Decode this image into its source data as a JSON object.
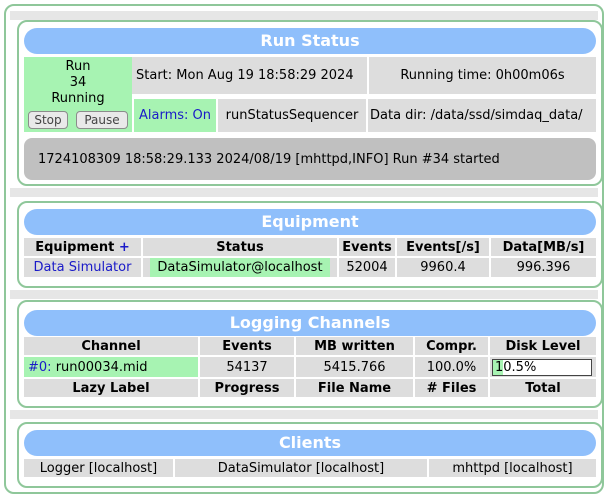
{
  "run_status": {
    "title": "Run Status",
    "run_label": "Run",
    "run_number": "34",
    "run_state": "Running",
    "stop_button": "Stop",
    "pause_button": "Pause",
    "start_time": "Start: Mon Aug 19 18:58:29 2024",
    "running_time": "Running time: 0h00m06s",
    "alarms": "Alarms: On",
    "sequencer": "runStatusSequencer",
    "data_dir": "Data dir: /data/ssd/simdaq_data/",
    "message": "1724108309 18:58:29.133 2024/08/19 [mhttpd,INFO] Run #34 started"
  },
  "equipment": {
    "title": "Equipment",
    "headers": {
      "name": "Equipment",
      "plus": "+",
      "status": "Status",
      "events": "Events",
      "rate": "Events[/s]",
      "data": "Data[MB/s]"
    },
    "rows": [
      {
        "name": "Data Simulator",
        "status": "DataSimulator@localhost",
        "events": "52004",
        "rate": "9960.4",
        "data": "996.396"
      }
    ]
  },
  "logging": {
    "title": "Logging Channels",
    "headers": {
      "channel": "Channel",
      "events": "Events",
      "mb": "MB written",
      "compr": "Compr.",
      "disk": "Disk Level"
    },
    "rows": [
      {
        "channel_id": "#0:",
        "file": "run00034.mid",
        "events": "54137",
        "mb": "5415.766",
        "compr": "100.0%",
        "disk": "10.5%",
        "disk_fraction": 0.105
      }
    ],
    "lazy_headers": {
      "label": "Lazy Label",
      "progress": "Progress",
      "file": "File Name",
      "files": "# Files",
      "total": "Total"
    }
  },
  "clients": {
    "title": "Clients",
    "items": [
      "Logger [localhost]",
      "DataSimulator [localhost]",
      "mhttpd [localhost]"
    ]
  },
  "colors": {
    "header": "#8fbffb",
    "green": "#a7f3b2",
    "border": "#8fc79a",
    "cell": "#dddddd",
    "message": "#c0c0c0"
  }
}
